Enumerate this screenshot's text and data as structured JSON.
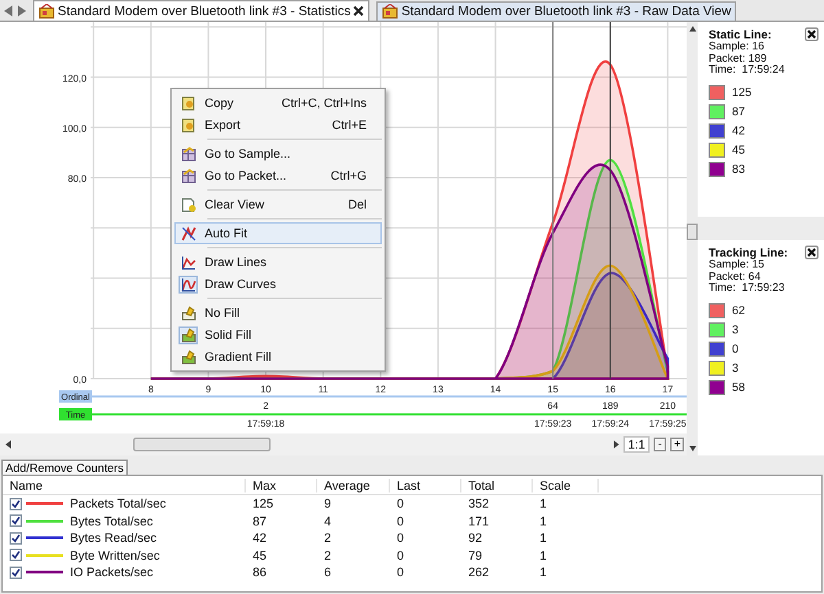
{
  "tabs": [
    {
      "label": "Standard Modem over Bluetooth link #3 - Statistics",
      "selected": true,
      "closable": true
    },
    {
      "label": "Standard Modem over Bluetooth link #3 - Raw Data View",
      "selected": false,
      "closable": false
    }
  ],
  "chart": {
    "chart_data": {
      "type": "area",
      "x": [
        8,
        9,
        10,
        11,
        12,
        13,
        14,
        15,
        16,
        17
      ],
      "xlim": [
        6.95,
        17.33
      ],
      "xticks": [
        8,
        9,
        10,
        11,
        12,
        13,
        14,
        15,
        16,
        17
      ],
      "ylim": [
        0,
        142
      ],
      "yticks": [
        {
          "value": 0,
          "label": "0,0"
        },
        {
          "value": 80,
          "label": "80,0"
        },
        {
          "value": 100,
          "label": "100,0"
        },
        {
          "value": 120,
          "label": "120,0"
        }
      ],
      "grid": true,
      "series": [
        {
          "color": "#f04040",
          "values": [
            0,
            0,
            1,
            0,
            0,
            0,
            0,
            62,
            125,
            3
          ]
        },
        {
          "color": "#50e040",
          "values": [
            0,
            0,
            0,
            0,
            0,
            0,
            0,
            3,
            87,
            3
          ]
        },
        {
          "color": "#3030d0",
          "values": [
            0,
            0,
            0,
            0,
            0,
            0,
            0,
            0,
            42,
            8
          ]
        },
        {
          "color": "#e8c000",
          "values": [
            0,
            0,
            0,
            0,
            0,
            0,
            0,
            3,
            45,
            0
          ]
        },
        {
          "color": "#800080",
          "values": [
            0,
            0,
            0,
            0,
            0,
            0,
            0,
            58,
            83,
            5
          ]
        }
      ],
      "ref_lines": [
        {
          "axis": "x",
          "value": 15
        },
        {
          "axis": "x",
          "value": 16
        }
      ]
    },
    "axis_rows": [
      {
        "label": "Ordinal",
        "color": "#a8c8f0",
        "values": [
          "2",
          "64",
          "189",
          "210"
        ]
      },
      {
        "label": "Time",
        "color": "#30e030",
        "values": [
          "17:59:18",
          "17:59:23",
          "17:59:24",
          "17:59:25"
        ]
      }
    ]
  },
  "context_menu": {
    "groups": [
      [
        {
          "label": "Copy",
          "shortcut": "Ctrl+C, Ctrl+Ins",
          "selected": false,
          "checked": false
        },
        {
          "label": "Export",
          "shortcut": "Ctrl+E",
          "selected": false,
          "checked": false
        }
      ],
      [
        {
          "label": "Go to Sample...",
          "selected": false,
          "checked": false
        },
        {
          "label": "Go to Packet...",
          "shortcut": "Ctrl+G",
          "selected": false,
          "checked": false
        }
      ],
      [
        {
          "label": "Clear View",
          "shortcut": "Del",
          "selected": false,
          "checked": false
        }
      ],
      [
        {
          "label": "Auto Fit",
          "selected": true,
          "checked": false
        }
      ],
      [
        {
          "label": "Draw Lines",
          "selected": false,
          "checked": false
        },
        {
          "label": "Draw Curves",
          "selected": false,
          "checked": true
        }
      ],
      [
        {
          "label": "No Fill",
          "selected": false,
          "checked": false
        },
        {
          "label": "Solid Fill",
          "selected": false,
          "checked": true
        },
        {
          "label": "Gradient Fill",
          "selected": false,
          "checked": false
        }
      ]
    ]
  },
  "zoom": {
    "ratio": "1:1",
    "buttons": [
      "-",
      "+"
    ]
  },
  "static_line": {
    "title": "Static Line:",
    "sample": "Sample: 16",
    "packet": "Packet: 189",
    "time": "Time:  17:59:24",
    "values": [
      {
        "color": "#f06060",
        "value": "125"
      },
      {
        "color": "#60f060",
        "value": "87"
      },
      {
        "color": "#4040d0",
        "value": "42"
      },
      {
        "color": "#f0f020",
        "value": "45"
      },
      {
        "color": "#900090",
        "value": "83"
      }
    ]
  },
  "tracking_line": {
    "title": "Tracking Line:",
    "sample": "Sample: 15",
    "packet": "Packet: 64",
    "time": "Time:  17:59:23",
    "values": [
      {
        "color": "#f06060",
        "value": "62"
      },
      {
        "color": "#60f060",
        "value": "3"
      },
      {
        "color": "#4040d0",
        "value": "0"
      },
      {
        "color": "#f0f020",
        "value": "3"
      },
      {
        "color": "#900090",
        "value": "58"
      }
    ]
  },
  "counters_tab": "Add/Remove Counters",
  "table": {
    "columns": [
      "Name",
      "Max",
      "Average",
      "Last",
      "Total",
      "Scale"
    ],
    "rows": [
      {
        "checked": true,
        "color": "#f04040",
        "cells": [
          "Packets Total/sec",
          "125",
          "9",
          "0",
          "352",
          "1"
        ]
      },
      {
        "checked": true,
        "color": "#50e040",
        "cells": [
          "Bytes Total/sec",
          "87",
          "4",
          "0",
          "171",
          "1"
        ]
      },
      {
        "checked": true,
        "color": "#3030d0",
        "cells": [
          "Bytes Read/sec",
          "42",
          "2",
          "0",
          "92",
          "1"
        ]
      },
      {
        "checked": true,
        "color": "#e8e020",
        "cells": [
          "Byte Written/sec",
          "45",
          "2",
          "0",
          "79",
          "1"
        ]
      },
      {
        "checked": true,
        "color": "#800080",
        "cells": [
          "IO Packets/sec",
          "86",
          "6",
          "0",
          "262",
          "1"
        ]
      }
    ]
  }
}
